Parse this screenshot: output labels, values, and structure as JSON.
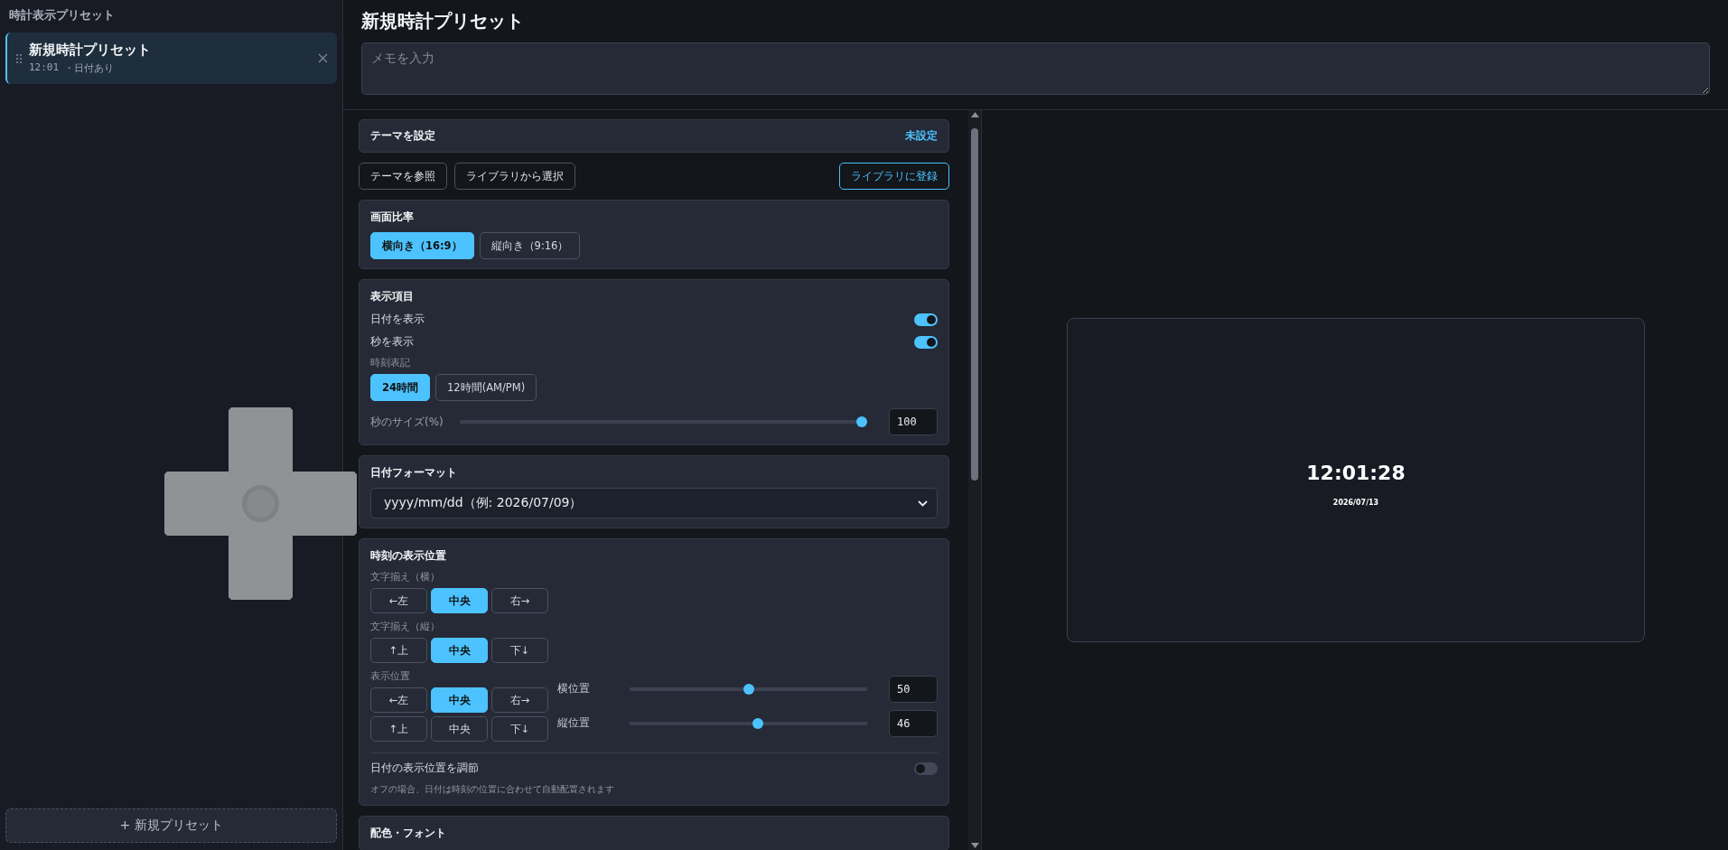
{
  "sidebar": {
    "heading": "時計表示プリセット",
    "presets": [
      {
        "title": "新規時計プリセット",
        "time": "12:01",
        "detail": "・日付あり",
        "selected": true
      }
    ],
    "add_button": "+ 新規プリセット"
  },
  "editor": {
    "title": "新規時計プリセット",
    "memo": {
      "placeholder": "メモを入力"
    }
  },
  "settings": {
    "theme": {
      "label": "テーマを設定",
      "status": "未設定"
    },
    "theme_buttons": [
      {
        "label": "テーマを参照",
        "kind": "plain"
      },
      {
        "label": "ライブラリから選択",
        "kind": "plain"
      },
      {
        "label": "ライブラリに登録",
        "kind": "accent"
      }
    ],
    "sections": [
      {
        "title": "画面比率",
        "rows": [
          {
            "kind": "segmented",
            "options": [
              {
                "label": "横向き（16:9）",
                "selected": true
              },
              {
                "label": "縦向き（9:16）",
                "selected": false
              }
            ]
          }
        ]
      },
      {
        "title": "表示項目",
        "rows": [
          {
            "kind": "toggle",
            "label": "日付を表示",
            "on": true
          },
          {
            "kind": "toggle",
            "label": "秒を表示",
            "on": true
          },
          {
            "kind": "caption",
            "text": "時刻表記"
          },
          {
            "kind": "segmented",
            "options": [
              {
                "label": "24時間",
                "selected": true
              },
              {
                "label": "12時間(AM/PM)",
                "selected": false
              }
            ]
          },
          {
            "kind": "slider",
            "label": "秒のサイズ(%)",
            "level": 1,
            "value": "100"
          }
        ]
      },
      {
        "title": "日付フォーマット",
        "rows": [
          {
            "kind": "select",
            "value": "yyyy/mm/dd（例: 2026/07/09）"
          }
        ]
      },
      {
        "title": "時刻の表示位置",
        "rows": [
          {
            "kind": "caption",
            "text": "文字揃え（横）"
          },
          {
            "kind": "grid",
            "options": [
              {
                "label": "←左",
                "selected": false
              },
              {
                "label": "中央",
                "selected": true
              },
              {
                "label": "右→",
                "selected": false
              }
            ]
          },
          {
            "kind": "caption",
            "text": "文字揃え（縦）"
          },
          {
            "kind": "grid",
            "options": [
              {
                "label": "↑上",
                "selected": false
              },
              {
                "label": "中央",
                "selected": true
              },
              {
                "label": "下↓",
                "selected": false
              }
            ]
          },
          {
            "kind": "position",
            "caption": "表示位置",
            "options": [
              {
                "label": "←左",
                "selected": false
              },
              {
                "label": "中央",
                "selected": true
              },
              {
                "label": "右→",
                "selected": false
              },
              {
                "label": "↑上",
                "selected": false
              },
              {
                "label": "中央",
                "selected": false
              },
              {
                "label": "下↓",
                "selected": false
              }
            ],
            "sliders": [
              {
                "label": "横位置",
                "level": 0.5,
                "value": "50"
              },
              {
                "label": "縦位置",
                "level": 0.54,
                "value": "46"
              }
            ]
          },
          {
            "kind": "toggle",
            "label": "日付の表示位置を調節",
            "on": false
          },
          {
            "kind": "note",
            "text": "オフの場合、日付は時刻の位置に合わせて自動配置されます"
          }
        ]
      },
      {
        "title": "配色・フォント"
      }
    ]
  },
  "preview": {
    "time": "12:01:28",
    "date": "2026/07/13"
  }
}
